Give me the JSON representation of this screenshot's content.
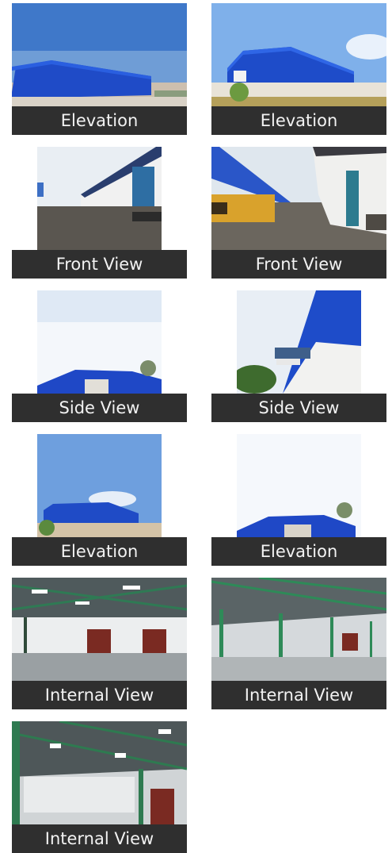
{
  "gallery": {
    "items": [
      {
        "caption": "Elevation"
      },
      {
        "caption": "Elevation"
      },
      {
        "caption": "Front View"
      },
      {
        "caption": "Front View"
      },
      {
        "caption": "Side View"
      },
      {
        "caption": "Side View"
      },
      {
        "caption": "Elevation"
      },
      {
        "caption": "Elevation"
      },
      {
        "caption": "Internal View"
      },
      {
        "caption": "Internal View"
      },
      {
        "caption": "Internal View"
      }
    ]
  },
  "colors": {
    "caption_bg": "#2f2f2f",
    "caption_text": "#f2f2f2",
    "cladding_blue": "#1f49c8"
  }
}
